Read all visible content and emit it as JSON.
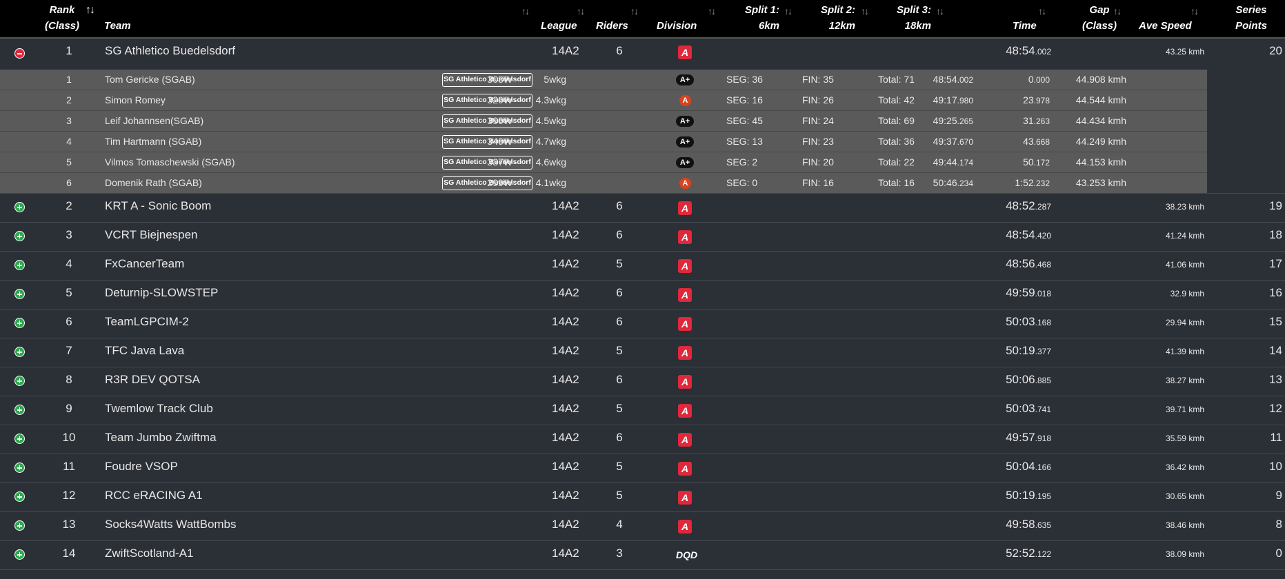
{
  "colors": {
    "header_bg": "#000000",
    "row_bg": "#2b2f36",
    "rider_row_bg": "#5a5a5a",
    "division_badge": "#e0283c",
    "expand_icon": "#2fa84f",
    "collapse_icon": "#e0283c"
  },
  "header": {
    "rank": [
      "Rank",
      "(Class)"
    ],
    "team": "Team",
    "league": "League",
    "riders": "Riders",
    "division": "Division",
    "split1": [
      "Split 1:",
      "6km"
    ],
    "split2": [
      "Split 2:",
      "12km"
    ],
    "split3": [
      "Split 3:",
      "18km"
    ],
    "time": "Time",
    "gap": [
      "Gap",
      "(Class)"
    ],
    "ave_speed": "Ave Speed",
    "series_points": [
      "Series",
      "Points"
    ],
    "sort_icon": "sort-icon"
  },
  "teams": [
    {
      "rank": "1",
      "name": "SG Athletico Buedelsdorf",
      "league": "14A2",
      "riders": "6",
      "division": "A",
      "time_main": "48:54",
      "time_ms": ".002",
      "speed": "43.25 kmh",
      "points": "20",
      "expanded": true
    },
    {
      "rank": "2",
      "name": "KRT A - Sonic Boom",
      "league": "14A2",
      "riders": "6",
      "division": "A",
      "time_main": "48:52",
      "time_ms": ".287",
      "speed": "38.23 kmh",
      "points": "19"
    },
    {
      "rank": "3",
      "name": "VCRT Biejnespen",
      "league": "14A2",
      "riders": "6",
      "division": "A",
      "time_main": "48:54",
      "time_ms": ".420",
      "speed": "41.24 kmh",
      "points": "18"
    },
    {
      "rank": "4",
      "name": "FxCancerTeam",
      "league": "14A2",
      "riders": "5",
      "division": "A",
      "time_main": "48:56",
      "time_ms": ".468",
      "speed": "41.06 kmh",
      "points": "17"
    },
    {
      "rank": "5",
      "name": "Deturnip-SLOWSTEP",
      "league": "14A2",
      "riders": "6",
      "division": "A",
      "time_main": "49:59",
      "time_ms": ".018",
      "speed": "32.9 kmh",
      "points": "16"
    },
    {
      "rank": "6",
      "name": "TeamLGPCIM-2",
      "league": "14A2",
      "riders": "6",
      "division": "A",
      "time_main": "50:03",
      "time_ms": ".168",
      "speed": "29.94 kmh",
      "points": "15"
    },
    {
      "rank": "7",
      "name": "TFC Java Lava",
      "league": "14A2",
      "riders": "5",
      "division": "A",
      "time_main": "50:19",
      "time_ms": ".377",
      "speed": "41.39 kmh",
      "points": "14"
    },
    {
      "rank": "8",
      "name": "R3R DEV QOTSA",
      "league": "14A2",
      "riders": "6",
      "division": "A",
      "time_main": "50:06",
      "time_ms": ".885",
      "speed": "38.27 kmh",
      "points": "13"
    },
    {
      "rank": "9",
      "name": "Twemlow Track Club",
      "league": "14A2",
      "riders": "5",
      "division": "A",
      "time_main": "50:03",
      "time_ms": ".741",
      "speed": "39.71 kmh",
      "points": "12"
    },
    {
      "rank": "10",
      "name": "Team Jumbo Zwiftma",
      "league": "14A2",
      "riders": "6",
      "division": "A",
      "time_main": "49:57",
      "time_ms": ".918",
      "speed": "35.59 kmh",
      "points": "11"
    },
    {
      "rank": "11",
      "name": "Foudre VSOP",
      "league": "14A2",
      "riders": "5",
      "division": "A",
      "time_main": "50:04",
      "time_ms": ".166",
      "speed": "36.42 kmh",
      "points": "10"
    },
    {
      "rank": "12",
      "name": "RCC eRACING A1",
      "league": "14A2",
      "riders": "5",
      "division": "A",
      "time_main": "50:19",
      "time_ms": ".195",
      "speed": "30.65 kmh",
      "points": "9"
    },
    {
      "rank": "13",
      "name": "Socks4Watts WattBombs",
      "league": "14A2",
      "riders": "4",
      "division": "A",
      "time_main": "49:58",
      "time_ms": ".635",
      "speed": "38.46 kmh",
      "points": "8"
    },
    {
      "rank": "14",
      "name": "ZwiftScotland-A1",
      "league": "14A2",
      "riders": "3",
      "division": "DQD",
      "time_main": "52:52",
      "time_ms": ".122",
      "speed": "38.09 kmh",
      "points": "0"
    }
  ],
  "riders": [
    {
      "rank": "1",
      "name": "Tom Gericke (SGAB)",
      "team_tag": "SG Athletico Buedelsdorf",
      "watts": "308W",
      "wkg": "5wkg",
      "category": "A+",
      "seg": "SEG: 36",
      "fin": "FIN: 35",
      "total": "Total: 71",
      "time_main": "48:54",
      "time_ms": ".002",
      "gap_main": "0",
      "gap_ms": ".000",
      "speed": "44.908 kmh"
    },
    {
      "rank": "2",
      "name": "Simon Romey",
      "team_tag": "SG Athletico Buedelsdorf",
      "watts": "320W",
      "wkg": "4.3wkg",
      "category": "A",
      "seg": "SEG: 16",
      "fin": "FIN: 26",
      "total": "Total: 42",
      "time_main": "49:17",
      "time_ms": ".980",
      "gap_main": "23",
      "gap_ms": ".978",
      "speed": "44.544 kmh"
    },
    {
      "rank": "3",
      "name": "Leif Johannsen(SGAB)",
      "team_tag": "SG Athletico Buedelsdorf",
      "watts": "390W",
      "wkg": "4.5wkg",
      "category": "A+",
      "seg": "SEG: 45",
      "fin": "FIN: 24",
      "total": "Total: 69",
      "time_main": "49:25",
      "time_ms": ".265",
      "gap_main": "31",
      "gap_ms": ".263",
      "speed": "44.434 kmh"
    },
    {
      "rank": "4",
      "name": "Tim Hartmann (SGAB)",
      "team_tag": "SG Athletico Buedelsdorf",
      "watts": "340W",
      "wkg": "4.7wkg",
      "category": "A+",
      "seg": "SEG: 13",
      "fin": "FIN: 23",
      "total": "Total: 36",
      "time_main": "49:37",
      "time_ms": ".670",
      "gap_main": "43",
      "gap_ms": ".668",
      "speed": "44.249 kmh"
    },
    {
      "rank": "5",
      "name": "Vilmos Tomaschewski (SGAB)",
      "team_tag": "SG Athletico Buedelsdorf",
      "watts": "337W",
      "wkg": "4.6wkg",
      "category": "A+",
      "seg": "SEG: 2",
      "fin": "FIN: 20",
      "total": "Total: 22",
      "time_main": "49:44",
      "time_ms": ".174",
      "gap_main": "50",
      "gap_ms": ".172",
      "speed": "44.153 kmh"
    },
    {
      "rank": "6",
      "name": "Domenik Rath (SGAB)",
      "team_tag": "SG Athletico Buedelsdorf",
      "watts": "299W",
      "wkg": "4.1wkg",
      "category": "A",
      "seg": "SEG: 0",
      "fin": "FIN: 16",
      "total": "Total: 16",
      "time_main": "50:46",
      "time_ms": ".234",
      "gap_main": "1:52",
      "gap_ms": ".232",
      "speed": "43.253 kmh"
    }
  ]
}
